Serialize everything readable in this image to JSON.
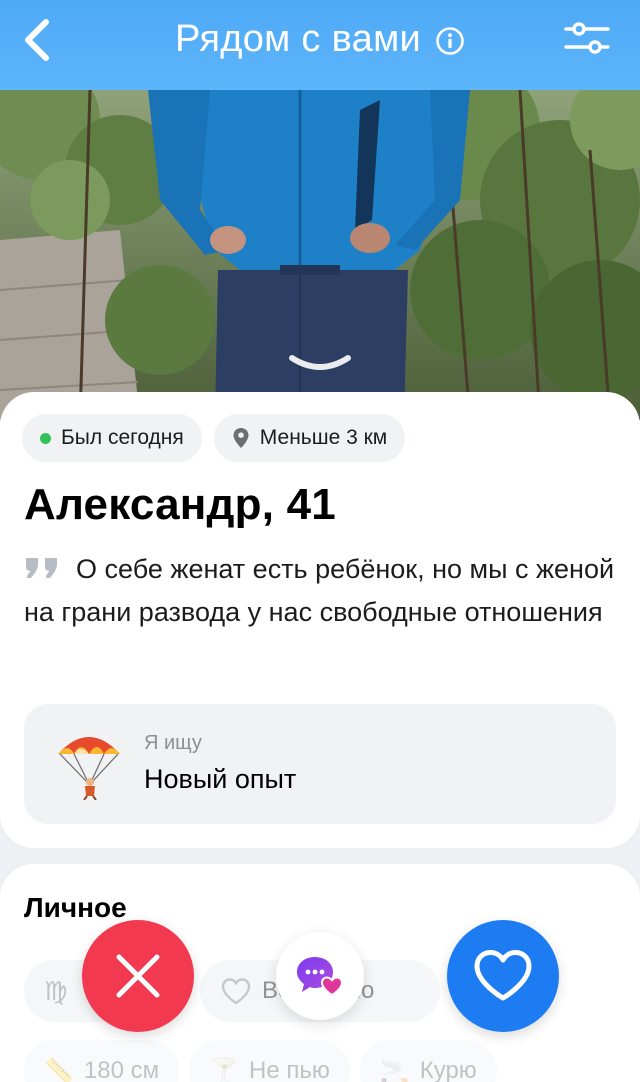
{
  "header": {
    "title": "Рядом с вами",
    "back_icon": "chevron-left-icon",
    "info_icon": "info-icon",
    "filter_icon": "sliders-icon",
    "bg_color": "#55aef8"
  },
  "profile": {
    "status": "Был сегодня",
    "status_color": "#32c05a",
    "distance": "Меньше 3 км",
    "name_age": "Александр, 41",
    "about": "О себе женат есть ребёнок, но мы с женой на грани развода у нас свободные отношения",
    "seeking_label": "Я ищу",
    "seeking_value": "Новый опыт",
    "seeking_icon": "parachute-icon"
  },
  "personal": {
    "title": "Личное",
    "tags": [
      {
        "icon": "virgo-icon",
        "label": ""
      },
      {
        "icon": "heart-outline-icon",
        "label": "Возможно"
      }
    ],
    "tags_row2": [
      {
        "icon": "ruler-icon",
        "label": "180 см"
      },
      {
        "icon": "glass-icon",
        "label": "Не пью"
      },
      {
        "icon": "smoke-icon",
        "label": "Курю"
      }
    ]
  },
  "actions": {
    "dislike_icon": "close-icon",
    "message_icon": "chat-heart-icon",
    "like_icon": "heart-icon",
    "dislike_color": "#f2394f",
    "like_color": "#1d7cf2"
  }
}
